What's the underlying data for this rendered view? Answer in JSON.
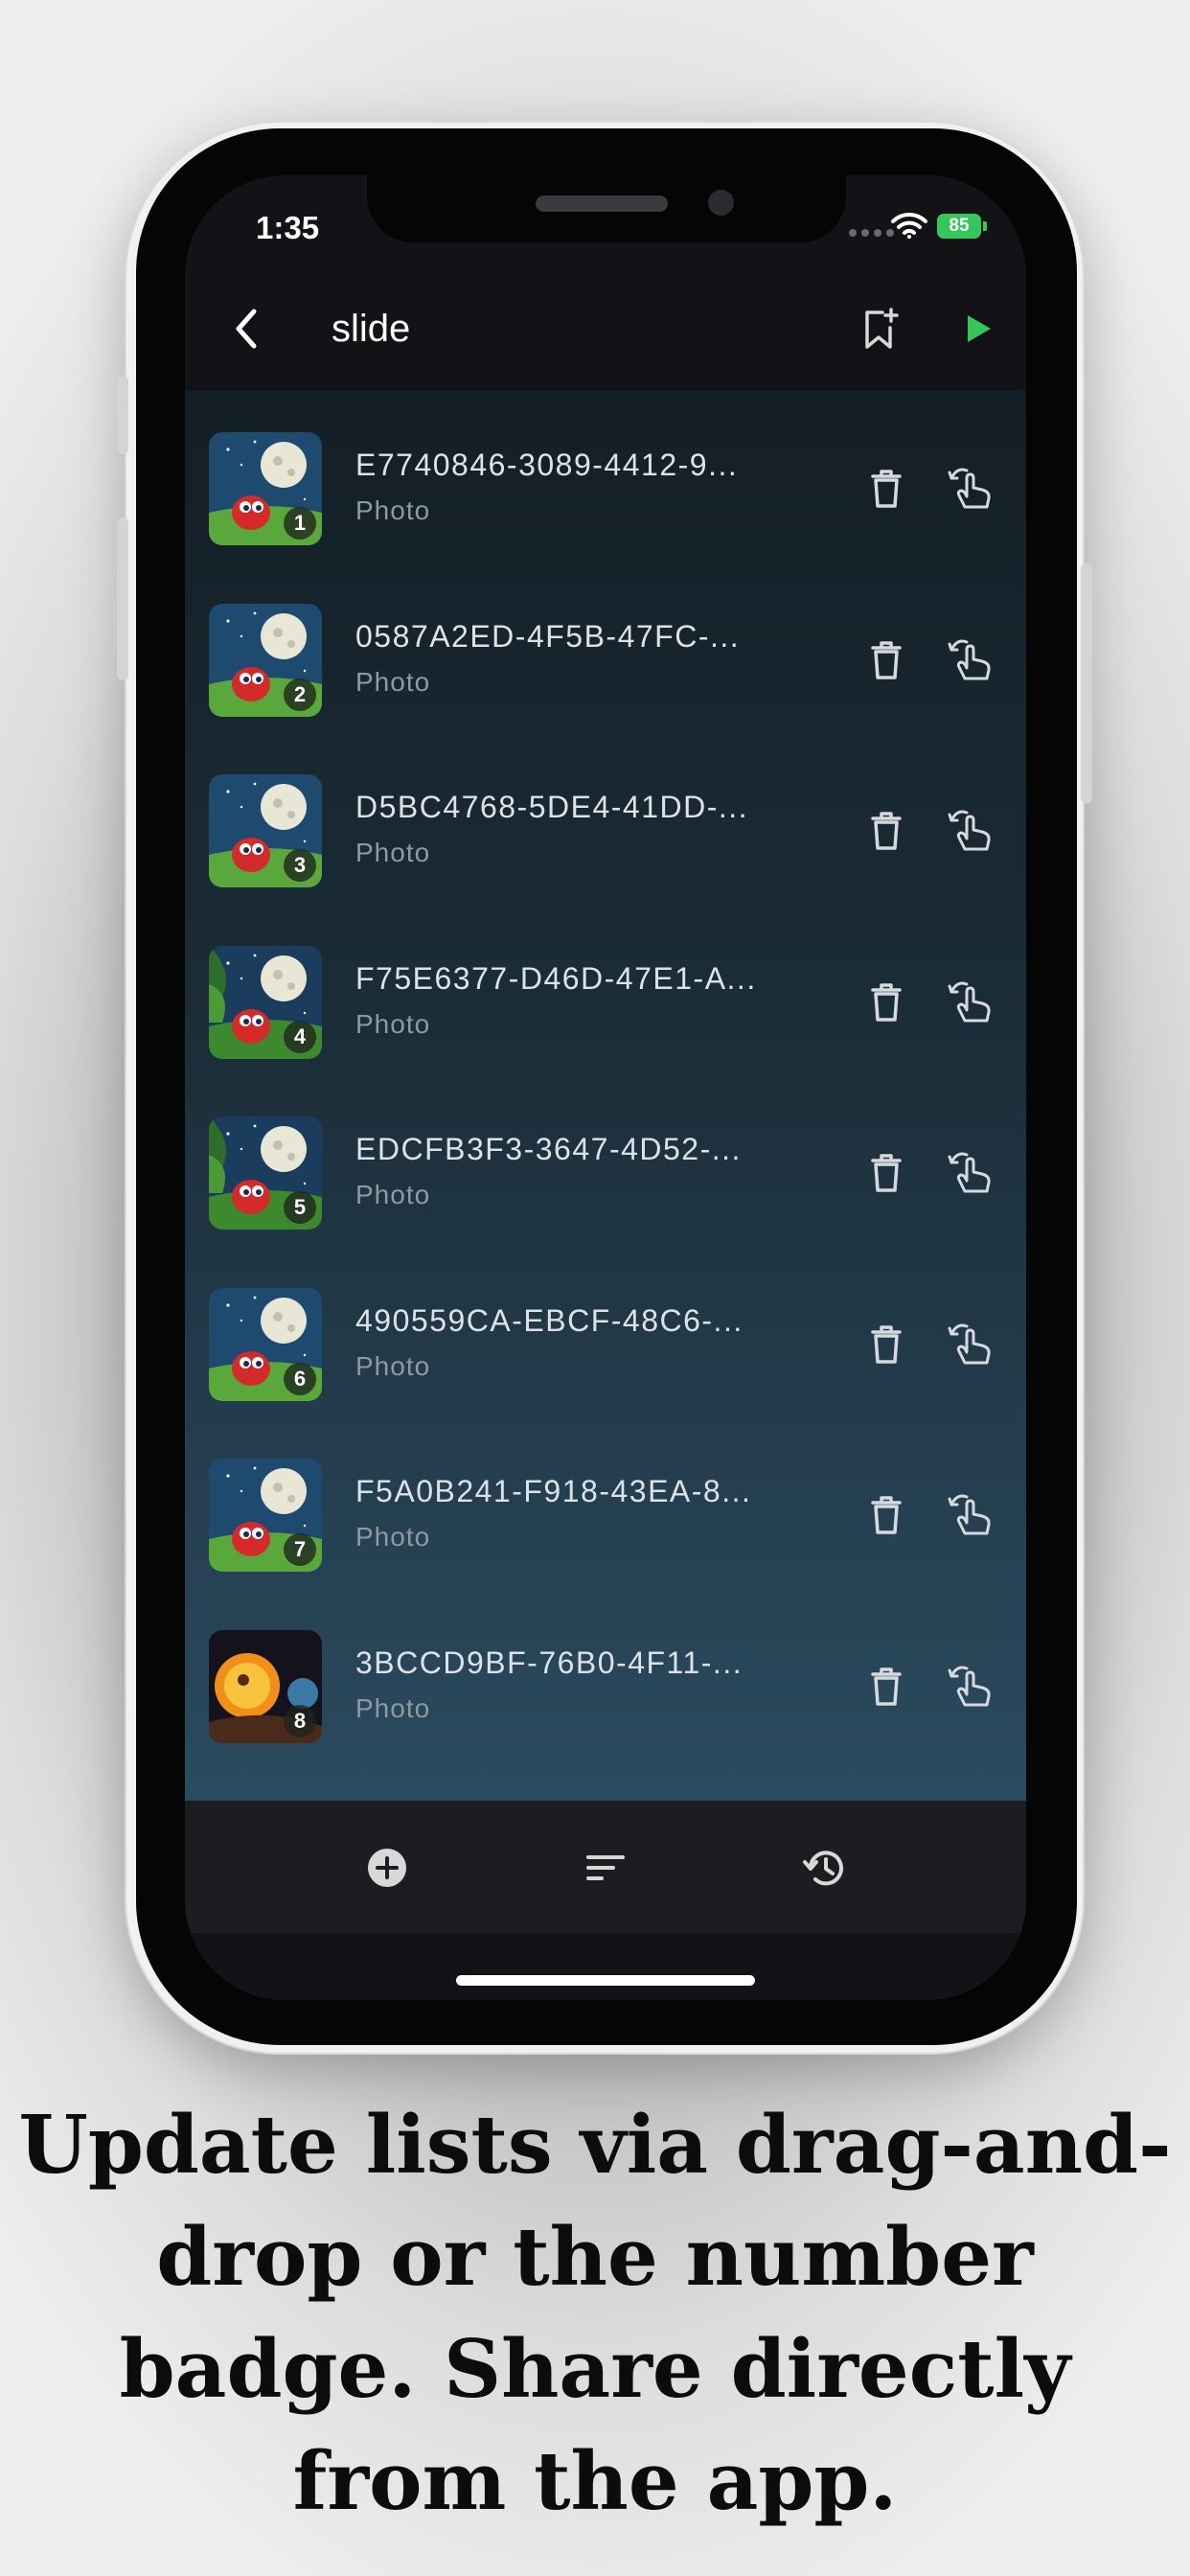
{
  "status_bar": {
    "time": "1:35",
    "battery": "85"
  },
  "navbar": {
    "back_icon": "chevron-left-icon",
    "title": "slide",
    "bookmark_icon": "bookmark-add-icon",
    "play_icon": "play-icon",
    "play_color": "#34c759"
  },
  "items": [
    {
      "title": "E7740846-3089-4412-9...",
      "subtitle": "Photo",
      "badge": "1",
      "scene": "moon-night"
    },
    {
      "title": "0587A2ED-4F5B-47FC-...",
      "subtitle": "Photo",
      "badge": "2",
      "scene": "moon-night"
    },
    {
      "title": "D5BC4768-5DE4-41DD-...",
      "subtitle": "Photo",
      "badge": "3",
      "scene": "moon-night"
    },
    {
      "title": "F75E6377-D46D-47E1-A...",
      "subtitle": "Photo",
      "badge": "4",
      "scene": "moon-jungle"
    },
    {
      "title": "EDCFB3F3-3647-4D52-...",
      "subtitle": "Photo",
      "badge": "5",
      "scene": "moon-jungle"
    },
    {
      "title": "490559CA-EBCF-48C6-...",
      "subtitle": "Photo",
      "badge": "6",
      "scene": "moon-night"
    },
    {
      "title": "F5A0B241-F918-43EA-8...",
      "subtitle": "Photo",
      "badge": "7",
      "scene": "moon-night"
    },
    {
      "title": "3BCCD9BF-76B0-4F11-...",
      "subtitle": "Photo",
      "badge": "8",
      "scene": "sun-space"
    }
  ],
  "item_icons": {
    "delete": "trash-icon",
    "drag": "drag-hand-icon"
  },
  "toolbar": {
    "add_icon": "add-circle-icon",
    "sort_icon": "sort-icon",
    "history_icon": "history-icon"
  },
  "caption": "Update lists via drag-and-drop or the number badge. Share directly from the app."
}
